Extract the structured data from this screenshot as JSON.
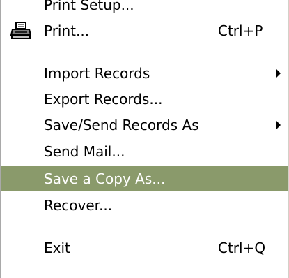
{
  "menu": {
    "items": [
      {
        "label": "Print Setup...",
        "shortcut": "",
        "has_submenu": false,
        "highlighted": false,
        "icon": ""
      },
      {
        "label": "Print...",
        "shortcut": "Ctrl+P",
        "has_submenu": false,
        "highlighted": false,
        "icon": "printer-icon"
      },
      {
        "label": "Import Records",
        "shortcut": "",
        "has_submenu": true,
        "highlighted": false,
        "icon": ""
      },
      {
        "label": "Export Records...",
        "shortcut": "",
        "has_submenu": false,
        "highlighted": false,
        "icon": ""
      },
      {
        "label": "Save/Send Records As",
        "shortcut": "",
        "has_submenu": true,
        "highlighted": false,
        "icon": ""
      },
      {
        "label": "Send Mail...",
        "shortcut": "",
        "has_submenu": false,
        "highlighted": false,
        "icon": ""
      },
      {
        "label": "Save a Copy As...",
        "shortcut": "",
        "has_submenu": false,
        "highlighted": true,
        "icon": ""
      },
      {
        "label": "Recover...",
        "shortcut": "",
        "has_submenu": false,
        "highlighted": false,
        "icon": ""
      },
      {
        "label": "Exit",
        "shortcut": "Ctrl+Q",
        "has_submenu": false,
        "highlighted": false,
        "icon": ""
      }
    ]
  },
  "colors": {
    "highlight_background": "#8a9a6b",
    "highlight_text": "#ffffff",
    "text": "#000000",
    "background": "#ffffff"
  }
}
